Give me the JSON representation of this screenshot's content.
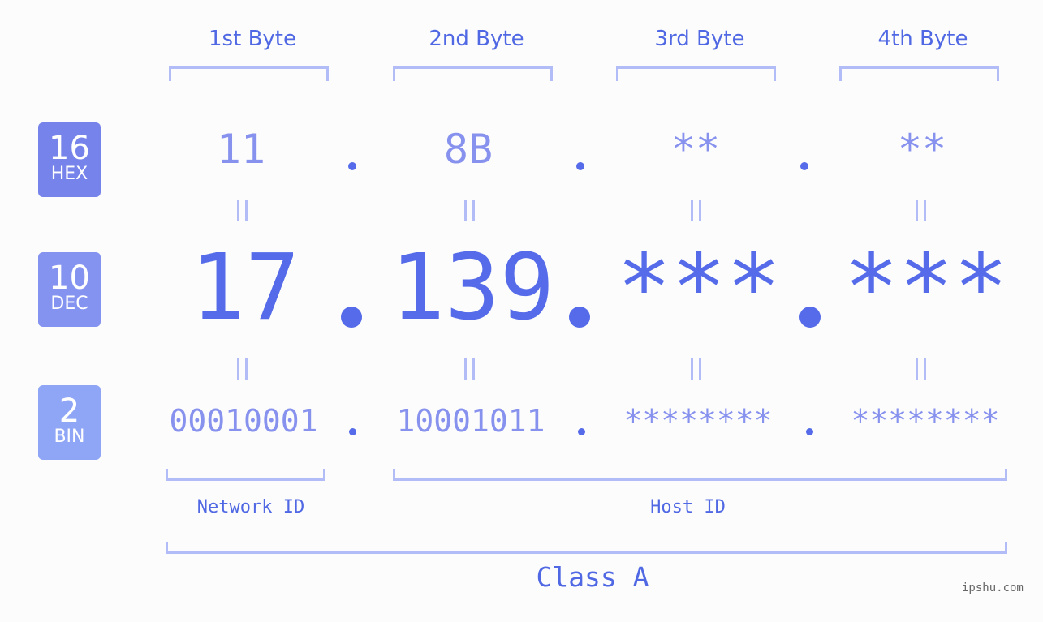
{
  "bytes": {
    "headers": [
      "1st Byte",
      "2nd Byte",
      "3rd Byte",
      "4th Byte"
    ]
  },
  "bases": {
    "hex": {
      "num": "16",
      "label": "HEX",
      "color": "#7583ea"
    },
    "dec": {
      "num": "10",
      "label": "DEC",
      "color": "#8593f0"
    },
    "bin": {
      "num": "2",
      "label": "BIN",
      "color": "#8fa5f6"
    }
  },
  "address": {
    "hex": [
      "11",
      "8B",
      "**",
      "**"
    ],
    "dec": [
      "17",
      "139",
      "***",
      "***"
    ],
    "bin": [
      "00010001",
      "10001011",
      "********",
      "********"
    ]
  },
  "segments": {
    "network": "Network ID",
    "host": "Host ID",
    "class": "Class A"
  },
  "watermark": "ipshu.com",
  "colors": {
    "primary": "#556be9",
    "light": "#8791ee",
    "bracket": "#b2bcf6"
  }
}
